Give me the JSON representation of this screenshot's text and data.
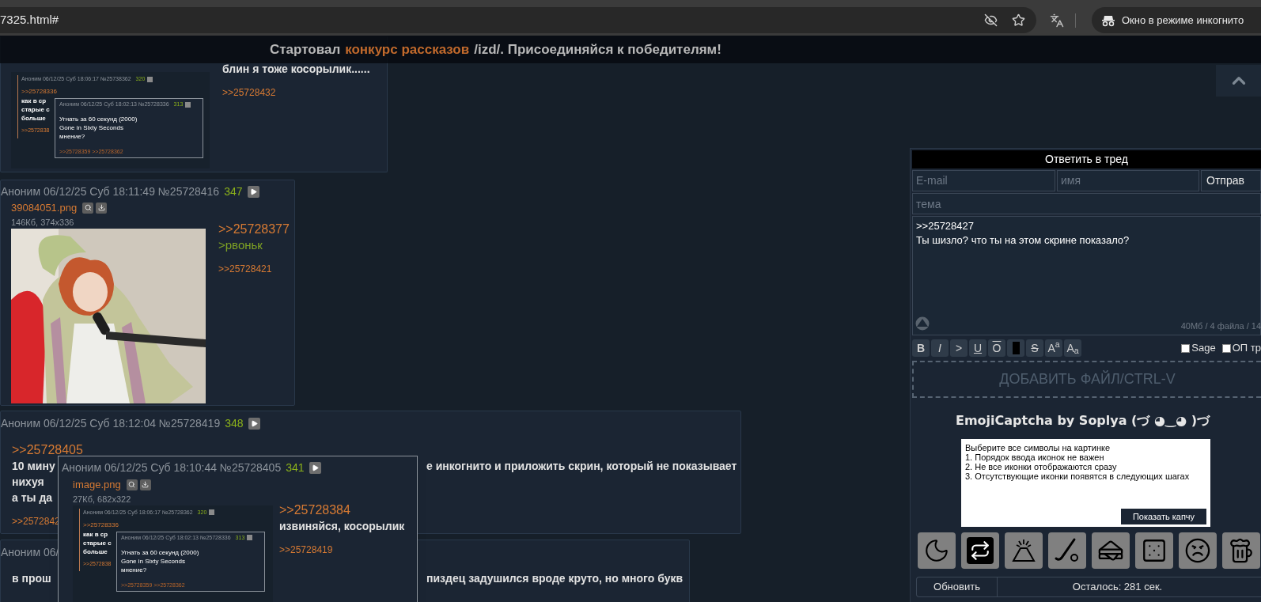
{
  "browser": {
    "url": "7325.html#",
    "incognito": "Окно в режиме инкогнито"
  },
  "banner": [
    {
      "kind": "plain",
      "text": "Стартовал"
    },
    {
      "kind": "link",
      "text": "конкурс рассказов"
    },
    {
      "kind": "plain",
      "text": "/izd/. Присоединяйся к победителям!"
    }
  ],
  "posts": [
    {
      "files": [
        {
          "media": {
            "kind": "screenshot",
            "header": "Аноним 06/12/25 Суб 18:06:17 №25738362",
            "count": "320",
            "reply": ">>25728336",
            "lines": [
              "как в ср",
              "старые с",
              "больше"
            ],
            "backlink": ">>2572838",
            "popup": {
              "header": "Аноним 06/12/25 Суб 18:02:13 №25728336",
              "count": "313",
              "lines": [
                "Угнать за 60 секунд (2000)",
                "Gone in Sixty Seconds",
                "мнение?"
              ],
              "backlinks": ">>25728359 >>25728362"
            }
          }
        }
      ],
      "body": [
        {
          "kind": "text",
          "text": "блин я тоже косорылик......"
        },
        {
          "kind": "backlink",
          "text": ">>25728432"
        }
      ]
    },
    {
      "header": {
        "text": "Аноним 06/12/25 Суб 18:11:49 №25728416",
        "count": "347"
      },
      "files": [
        {
          "name": "39084051.png",
          "size": "146Кб, 374x336"
        }
      ],
      "body": [
        {
          "kind": "reply",
          "text": ">>25728377"
        },
        {
          "kind": "greentext",
          "text": ">рвоньк"
        },
        {
          "kind": "backlink",
          "text": ">>25728421"
        }
      ]
    },
    {
      "header": {
        "text": "Аноним 06/12/25 Суб 18:12:04 №25728419",
        "count": "348"
      },
      "body": [
        {
          "kind": "reply",
          "text": ">>25728405"
        },
        {
          "kind": "text",
          "text": "10 мину",
          "right": "е инкогнито и приложить скрин, который не показывает"
        },
        {
          "kind": "text",
          "text": "нихуя"
        },
        {
          "kind": "text",
          "text": "а ты да"
        },
        {
          "kind": "backlink",
          "text": ">>2572842"
        }
      ]
    },
    {
      "header": {
        "text": "Аноним 06/"
      },
      "body": [
        {
          "kind": "text",
          "text": "в прош",
          "right": "пиздец задушился вроде круто, но много букв"
        }
      ]
    }
  ],
  "popup": {
    "header": {
      "text": "Аноним 06/12/25 Суб 18:10:44 №25728405",
      "count": "341"
    },
    "files": [
      {
        "name": "image.png",
        "size": "27Кб, 682x322",
        "media": {
          "kind": "screenshot",
          "header": "Аноним 06/12/25 Суб 18:06:17 №25728362",
          "count": "320",
          "reply": ">>25728336",
          "lines": [
            "как в ср",
            "старые с",
            "больше"
          ],
          "backlink": ">>2572838",
          "popup": {
            "header": "Аноним 06/12/25 Суб 18:02:13 №25728336",
            "count": "313",
            "lines": [
              "Угнать за 60 секунд (2000)",
              "Gone in Sixty Seconds",
              "мнение?"
            ],
            "backlinks": ">>25728359 >>25728362"
          }
        }
      }
    ],
    "body": [
      {
        "kind": "reply",
        "text": ">>25728384"
      },
      {
        "kind": "text",
        "text": "извиняйся, косорылик"
      },
      {
        "kind": "backlink",
        "text": ">>25728419"
      }
    ]
  },
  "form": {
    "title": "Ответить в тред",
    "email_placeholder": "E-mail",
    "name_placeholder": "имя",
    "submit": "Отправ",
    "subject_placeholder": "тема",
    "message": ">>25728427\nТы шизло? что ты на этом скрине показало?",
    "limits": "40Мб / 4 файла / 14",
    "format_buttons": [
      {
        "kind": "bold",
        "label": "B"
      },
      {
        "kind": "italic",
        "label": "I"
      },
      {
        "kind": "plain",
        "label": ">"
      },
      {
        "kind": "underline",
        "label": "U"
      },
      {
        "kind": "overline",
        "label": "O"
      },
      {
        "kind": "spoiler"
      },
      {
        "kind": "strike",
        "label": "S"
      },
      {
        "kind": "rich",
        "label": "A$^{a}$"
      },
      {
        "kind": "rich",
        "label": "A$_{a}$"
      }
    ],
    "checkboxes": [
      {
        "label": "Sage",
        "checked": false
      },
      {
        "label": "ОП тр",
        "checked": false
      }
    ],
    "dropzone": "ДОБАВИТЬ ФАЙЛ/CTRL-V"
  },
  "captcha": {
    "title": "EmojiCaptcha by Soplya (づ ◕‿◕ )づ",
    "instructions": [
      "Выберите все символы на картинке",
      "1. Порядок ввода иконок не важен",
      "2. Не все иконки отображаются сразу",
      "3. Отсутствующие иконки появятся в следующих шагах"
    ],
    "show_button": "Показать капчу",
    "refresh": "Обновить",
    "timer": "Осталось: 281 сек."
  }
}
